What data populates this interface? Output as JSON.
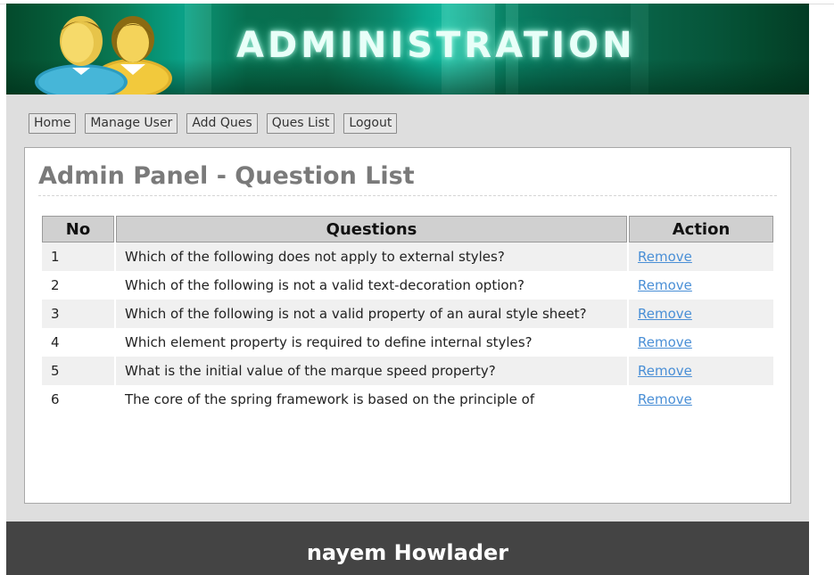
{
  "header": {
    "banner_title": "ADMINISTRATION",
    "logo_icon": "users-icon"
  },
  "nav": {
    "items": [
      {
        "label": "Home"
      },
      {
        "label": "Manage User"
      },
      {
        "label": "Add Ques"
      },
      {
        "label": "Ques List"
      },
      {
        "label": "Logout"
      }
    ]
  },
  "panel": {
    "title": "Admin Panel - Question List"
  },
  "table": {
    "headers": {
      "no": "No",
      "questions": "Questions",
      "action": "Action"
    },
    "rows": [
      {
        "no": "1",
        "question": "Which of the following does not apply to external styles?",
        "action": "Remove"
      },
      {
        "no": "2",
        "question": "Which of the following is not a valid text-decoration option?",
        "action": "Remove"
      },
      {
        "no": "3",
        "question": "Which of the following is not a valid property of an aural style sheet?",
        "action": "Remove"
      },
      {
        "no": "4",
        "question": "Which element property is required to define internal styles?",
        "action": "Remove"
      },
      {
        "no": "5",
        "question": "What is the initial value of the marque speed property?",
        "action": "Remove"
      },
      {
        "no": "6",
        "question": "The core of the spring framework is based on the principle of",
        "action": "Remove"
      }
    ]
  },
  "footer": {
    "text": "nayem Howlader"
  },
  "colors": {
    "header_green": "#0a7a55",
    "footer_bg": "#444444",
    "link": "#4a8fd6",
    "title_gray": "#7a7a7a"
  }
}
